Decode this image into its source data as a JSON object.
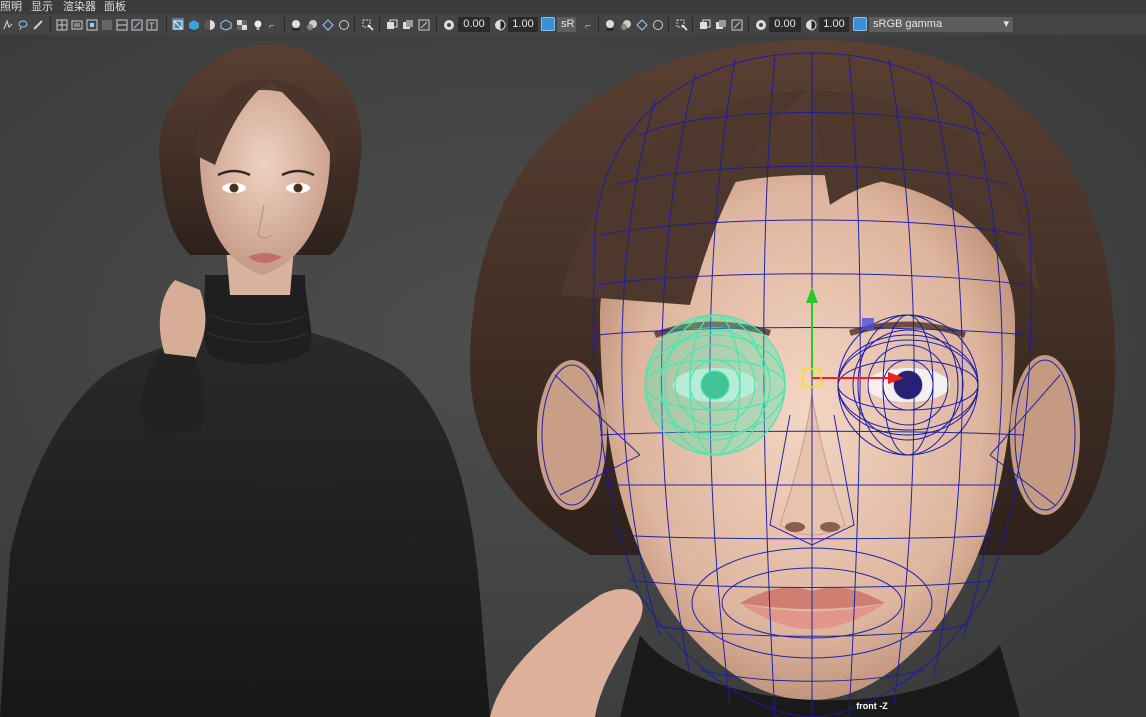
{
  "menu": {
    "items": [
      "照明",
      "显示",
      "渲染器",
      "面板"
    ]
  },
  "toolbar_left": {
    "exposure_value": "0.00",
    "gamma_value": "1.00",
    "color_space_partial": "sR"
  },
  "toolbar_right": {
    "exposure_value": "0.00",
    "gamma_value": "1.00",
    "color_space": "sRGB gamma"
  },
  "viewport": {
    "camera_label": "front -Z"
  },
  "colors": {
    "toolbar_bg": "#444444",
    "viewport_bg": "#404040",
    "wireframe": "#1b1ba8",
    "selected_eye": "#45e8b0",
    "move_y": "#22cc22",
    "move_x": "#ee2222",
    "badge": "#3b8fd2"
  },
  "icons": [
    "select-icon",
    "lasso-icon",
    "paint-icon",
    "grid-icon",
    "camera-icon",
    "wireframe-icon",
    "shaded-icon",
    "lighting-icon",
    "light-bulb-icon",
    "shadow-icon",
    "xray-icon",
    "isolate-icon",
    "exposure-icon",
    "gamma-icon",
    "color-space-icon",
    "dropdown-arrow-icon"
  ]
}
